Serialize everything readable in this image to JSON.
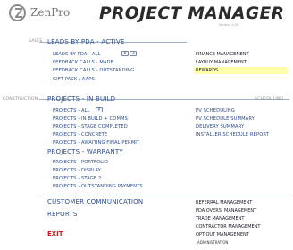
{
  "header": {
    "brand": "ZenPro",
    "title": "PROJECT MANAGER",
    "version": "Version 1.01"
  },
  "sections": {
    "sales": "SALES",
    "construction": "CONSTRUCTION",
    "scheduling": "SCHEDULING"
  },
  "leads": {
    "header": "LEADS BY PDA - ACTIVE",
    "items": [
      "LEADS BY PDA - ALL",
      "FEEDBACK CALLS - MADE",
      "FEEDBACK CALLS - OUTSTANDING",
      "GIFT PACK / AAPS"
    ],
    "icon1": "P",
    "icon2": "↗"
  },
  "finance": {
    "items": [
      "FINANCE MANAGEMENT",
      "LAYBUY MANAGEMENT",
      "REWARDS"
    ]
  },
  "projects_in_build": {
    "header": "PROJECTS - IN BUILD",
    "items": [
      "PROJECTS - ALL",
      "PROJECTS - IN BUILD + COMMS",
      "PROJECTS - STAGE COMPLETED",
      "PROJECTS - CONCRETE",
      "PROJECTS - AWAITING FINAL PERMIT"
    ],
    "icon": "P"
  },
  "schedule": {
    "items": [
      "PV SCHEDULING",
      "PV SCHEDULE SUMMARY",
      "DELIVERY SUMMARY",
      "INSTALLER SCHEDULE REPORT"
    ]
  },
  "projects_warranty": {
    "header": "PROJECTS - WARRANTY",
    "items": [
      "PROJECTS - PORTFOLIO",
      "PROJECTS - DISPLAY",
      "PROJECTS - STAGE 2",
      "PROJECTS - OUTSTANDING PAYMENTS"
    ]
  },
  "bottom": {
    "customer_communication": "CUSTOMER COMMUNICATION",
    "reports": "REPORTS",
    "exit": "EXIT"
  },
  "management": {
    "items": [
      "REFERRAL MANAGEMENT",
      "PDA OVERS. MANAGEMENT",
      "TRADE MANAGEMENT",
      "CONTRACTOR MANAGEMENT",
      "OPT-OUT MANAGEMENT"
    ],
    "admin": "ADMINISTRATION"
  }
}
